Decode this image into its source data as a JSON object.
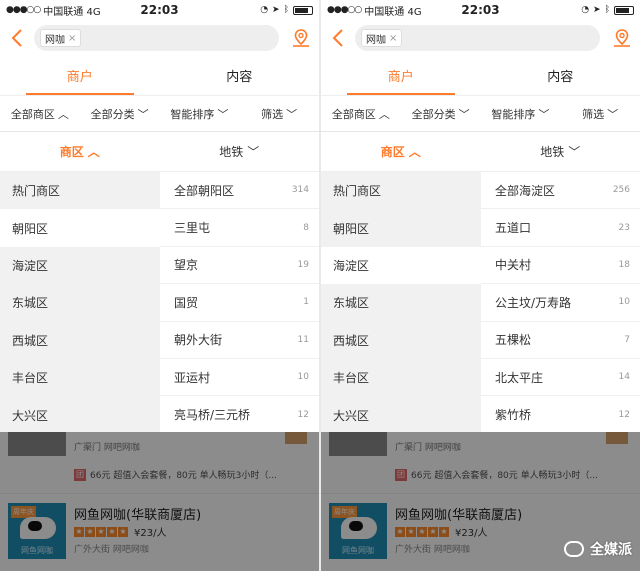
{
  "colors": {
    "accent": "#ff7b2b",
    "overlay": "rgba(0,0,0,0.45)"
  },
  "status_bar": {
    "carrier": "中国联通",
    "network": "4G",
    "time": "22:03"
  },
  "nav": {
    "search_chip": "网咖",
    "back_icon": "chevron-left-icon",
    "location_icon": "map-pin-icon"
  },
  "tabs": [
    "商户",
    "内容"
  ],
  "filters": [
    "全部商区",
    "全部分类",
    "智能排序",
    "筛选"
  ],
  "dropdown_tabs": [
    "商区",
    "地铁"
  ],
  "districts": [
    "热门商区",
    "朝阳区",
    "海淀区",
    "东城区",
    "西城区",
    "丰台区",
    "大兴区"
  ],
  "screens": [
    {
      "selected_district": 1,
      "areas": [
        {
          "name": "全部朝阳区",
          "count": "314"
        },
        {
          "name": "三里屯",
          "count": "8"
        },
        {
          "name": "望京",
          "count": "19"
        },
        {
          "name": "国贸",
          "count": "1"
        },
        {
          "name": "朝外大街",
          "count": "11"
        },
        {
          "name": "亚运村",
          "count": "10"
        },
        {
          "name": "亮马桥/三元桥",
          "count": "12"
        }
      ]
    },
    {
      "selected_district": 2,
      "areas": [
        {
          "name": "全部海淀区",
          "count": "256"
        },
        {
          "name": "五道口",
          "count": "23"
        },
        {
          "name": "中关村",
          "count": "18"
        },
        {
          "name": "公主坟/万寿路",
          "count": "10"
        },
        {
          "name": "五棵松",
          "count": "7"
        },
        {
          "name": "北太平庄",
          "count": "14"
        },
        {
          "name": "紫竹桥",
          "count": "12"
        }
      ]
    }
  ],
  "list": {
    "prev_meta": "广渠门   网吧网咖",
    "promo_tag": "团",
    "promo": "66元 超值入会套餐，80元 单人畅玩3小时（...",
    "card": {
      "name": "网鱼网咖(华联商厦店)",
      "price": "¥23/人",
      "meta": "广外大街   网吧网咖",
      "badge": "周年庆",
      "logo": "网鱼网咖",
      "stars": 5
    }
  },
  "watermark": "全媒派"
}
